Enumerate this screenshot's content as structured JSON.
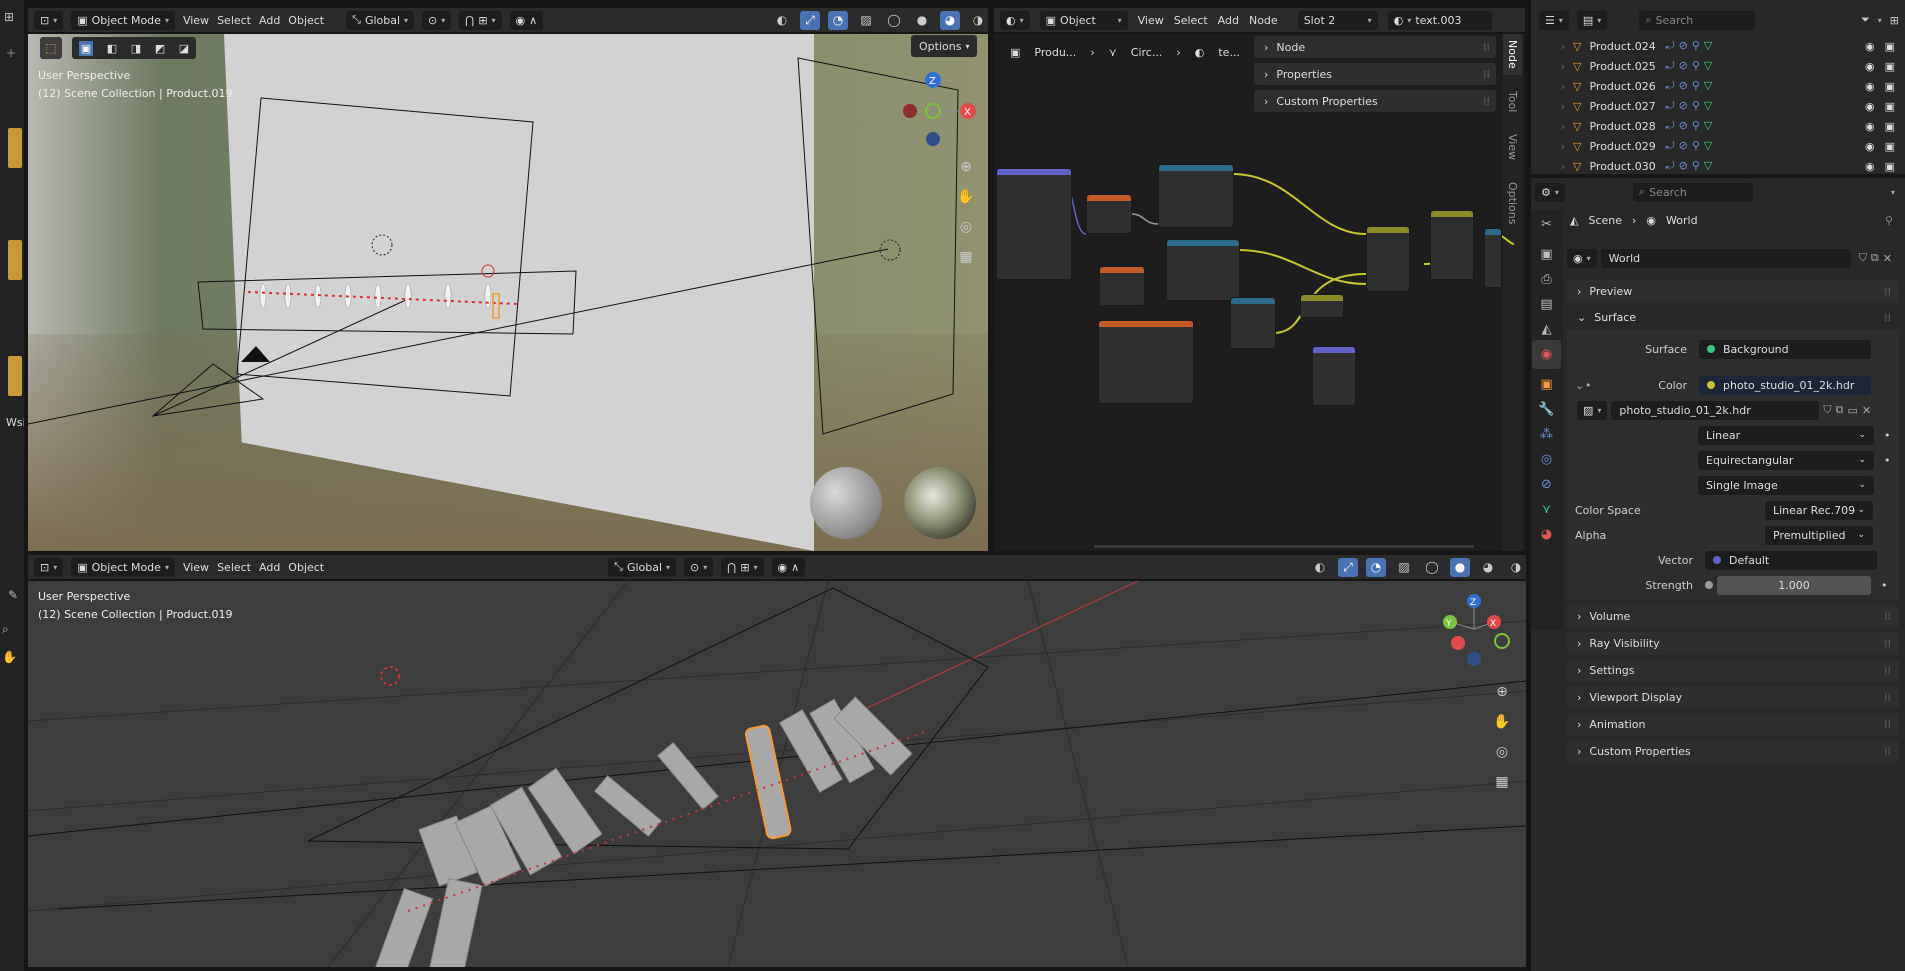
{
  "top_viewport": {
    "mode": "Object Mode",
    "menus": [
      "View",
      "Select",
      "Add",
      "Object"
    ],
    "transform": "Global",
    "options_label": "Options",
    "perspective": "User Perspective",
    "collection": "(12) Scene Collection | Product.019"
  },
  "bottom_viewport": {
    "mode": "Object Mode",
    "menus": [
      "View",
      "Select",
      "Add",
      "Object"
    ],
    "transform": "Global",
    "perspective": "User Perspective",
    "collection": "(12) Scene Collection | Product.019"
  },
  "left_strip": {
    "label": "Wsi"
  },
  "node_editor": {
    "type": "Object",
    "menus": [
      "View",
      "Select",
      "Add",
      "Node"
    ],
    "slot": "Slot 2",
    "material": "text.003",
    "breadcrumb": [
      "Produ...",
      "Circ...",
      "te..."
    ],
    "panels": [
      "Node",
      "Properties",
      "Custom Properties"
    ],
    "side_tabs": [
      "Node",
      "Tool",
      "View",
      "Options"
    ]
  },
  "outliner": {
    "search_placeholder": "Search",
    "rows": [
      "Product.024",
      "Product.025",
      "Product.026",
      "Product.027",
      "Product.028",
      "Product.029",
      "Product.030"
    ]
  },
  "properties": {
    "search_placeholder": "Search",
    "breadcrumb": [
      "Scene",
      "World"
    ],
    "world_name": "World",
    "sections": {
      "preview": "Preview",
      "surface": "Surface",
      "volume": "Volume",
      "ray_visibility": "Ray Visibility",
      "settings": "Settings",
      "viewport_display": "Viewport Display",
      "animation": "Animation",
      "custom_properties": "Custom Properties"
    },
    "surface_label": "Surface",
    "surface_value": "Background",
    "color_label": "Color",
    "color_value": "photo_studio_01_2k.hdr",
    "image_name": "photo_studio_01_2k.hdr",
    "interpolation": "Linear",
    "projection": "Equirectangular",
    "source": "Single Image",
    "color_space_label": "Color Space",
    "color_space": "Linear Rec.709",
    "alpha_label": "Alpha",
    "alpha": "Premultiplied",
    "vector_label": "Vector",
    "vector": "Default",
    "strength_label": "Strength",
    "strength": "1.000"
  },
  "colors": {
    "accent": "#4772b3",
    "selection": "#f59a31",
    "socket_yellow": "#c7c729",
    "socket_blue": "#6363c7",
    "socket_green": "#39c884"
  }
}
